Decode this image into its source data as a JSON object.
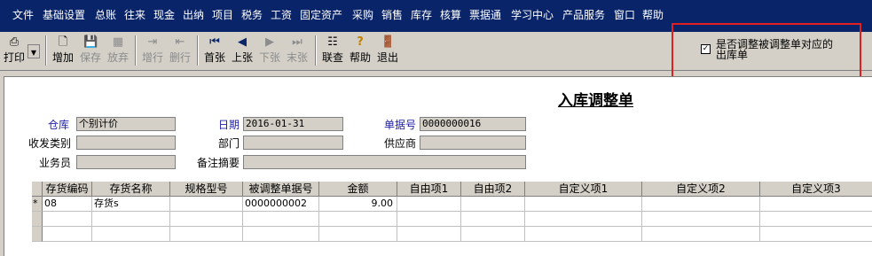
{
  "menu": [
    "文件",
    "基础设置",
    "总账",
    "往来",
    "现金",
    "出纳",
    "项目",
    "税务",
    "工资",
    "固定资产",
    "采购",
    "销售",
    "库存",
    "核算",
    "票据通",
    "学习中心",
    "产品服务",
    "窗口",
    "帮助"
  ],
  "toolbar": {
    "print": "打印",
    "add": "增加",
    "save": "保存",
    "discard": "放弃",
    "add_row": "增行",
    "delete_row": "删行",
    "first": "首张",
    "prev": "上张",
    "next": "下张",
    "last": "末张",
    "link_query": "联查",
    "help": "帮助",
    "exit": "退出"
  },
  "option": {
    "checked": true,
    "check_mark": "✓",
    "label": "是否调整被调整单对应的出库单"
  },
  "form": {
    "title": "入库调整单",
    "warehouse_label": "仓库",
    "warehouse_value": "个别计价",
    "date_label": "日期",
    "date_value": "2016-01-31",
    "doc_no_label": "单据号",
    "doc_no_value": "0000000016",
    "io_type_label": "收发类别",
    "io_type_value": "",
    "dept_label": "部门",
    "dept_value": "",
    "supplier_label": "供应商",
    "supplier_value": "",
    "clerk_label": "业务员",
    "clerk_value": "",
    "remark_label": "备注摘要",
    "remark_value": ""
  },
  "grid": {
    "columns": [
      "存货编码",
      "存货名称",
      "规格型号",
      "被调整单据号",
      "金额",
      "自由项1",
      "自由项2",
      "自定义项1",
      "自定义项2",
      "自定义项3"
    ],
    "rows": [
      {
        "marker": "*",
        "code": "08",
        "name": "存货s",
        "spec": "",
        "ref_no": "0000000002",
        "amount": "9.00",
        "free1": "",
        "free2": "",
        "custom1": "",
        "custom2": "",
        "custom3": ""
      }
    ]
  }
}
